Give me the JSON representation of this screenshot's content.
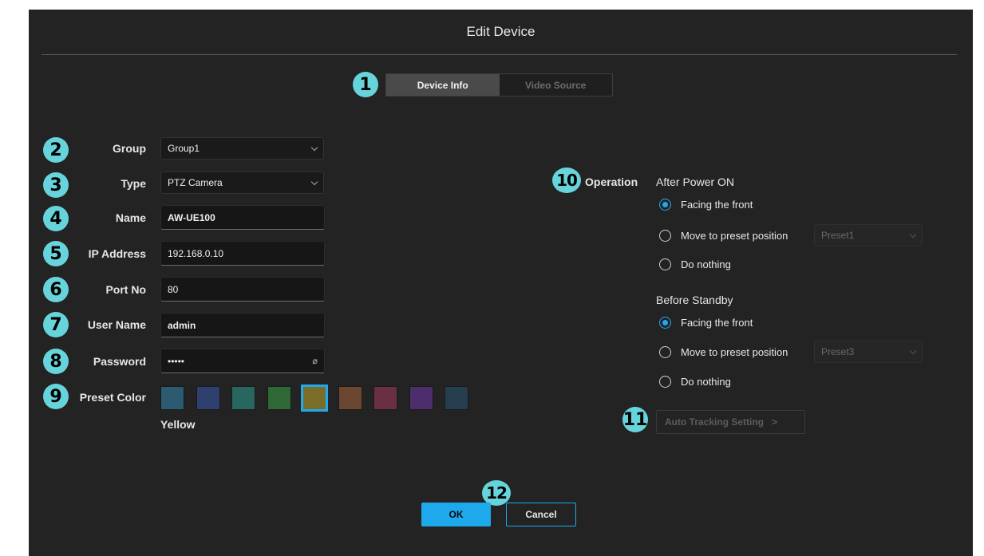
{
  "dialog": {
    "title": "Edit Device"
  },
  "tabs": [
    {
      "label": "Device Info",
      "active": true
    },
    {
      "label": "Video Source",
      "active": false
    }
  ],
  "badges": [
    "1",
    "2",
    "3",
    "4",
    "5",
    "6",
    "7",
    "8",
    "9",
    "10",
    "11",
    "12"
  ],
  "form": {
    "group": {
      "label": "Group",
      "value": "Group1"
    },
    "type": {
      "label": "Type",
      "value": "PTZ Camera"
    },
    "name": {
      "label": "Name",
      "value": "AW-UE100"
    },
    "ip": {
      "label": "IP Address",
      "value": "192.168.0.10"
    },
    "port": {
      "label": "Port No",
      "value": "80"
    },
    "user": {
      "label": "User Name",
      "value": "admin"
    },
    "password": {
      "label": "Password",
      "value": "•••••"
    },
    "preset_color": {
      "label": "Preset Color",
      "selected_name": "Yellow",
      "colors": [
        "#2c5a70",
        "#2f3f6e",
        "#2a6660",
        "#2f6a36",
        "#7a6d28",
        "#6b4630",
        "#6b2f44",
        "#4c2e6c",
        "#253f4f"
      ],
      "selected_index": 4
    }
  },
  "operation": {
    "label": "Operation",
    "after_power_on": {
      "title": "After Power ON",
      "options": [
        "Facing the front",
        "Move to preset position",
        "Do nothing"
      ],
      "selected": 0,
      "preset_value": "Preset1"
    },
    "before_standby": {
      "title": "Before Standby",
      "options": [
        "Facing the front",
        "Move to preset position",
        "Do nothing"
      ],
      "selected": 0,
      "preset_value": "Preset3"
    },
    "auto_tracking_label": "Auto Tracking Setting",
    "auto_tracking_arrow": ">"
  },
  "footer": {
    "ok_label": "OK",
    "cancel_label": "Cancel"
  },
  "colors": {
    "accent": "#1ea9ec",
    "badge": "#67d4dc",
    "background": "#232323"
  }
}
